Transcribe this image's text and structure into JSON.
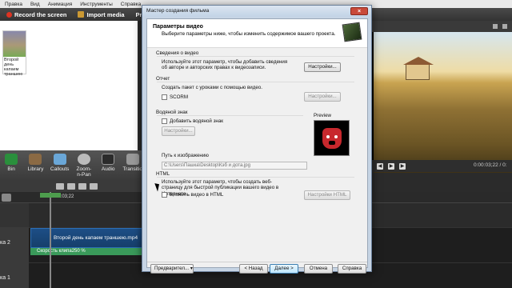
{
  "menu": [
    "Правка",
    "Вид",
    "Анимация",
    "Инструменты",
    "Справка"
  ],
  "toolbar": {
    "record": "Record the screen",
    "import": "Import media",
    "produce": "Produ"
  },
  "bin": {
    "clip_caption": "Второй день капаем траншею"
  },
  "tools": [
    "Bin",
    "Library",
    "Callouts",
    "Zoom-n-Pan",
    "Audio",
    "Transitio"
  ],
  "timeline": {
    "time": "0:00:03;22",
    "track2": "ка 2",
    "track1": "ка 1",
    "clip_name": "Второй день капаем траншею.mp4",
    "speed": "Скорость клипа250 %"
  },
  "player": {
    "timecode": "0:00:03;22 / 0:"
  },
  "dialog": {
    "title": "Мастер создания фильма",
    "header_title": "Параметры видео",
    "header_sub": "Выберите параметры ниже, чтобы изменить содержимое вашего проекта.",
    "s1_title": "Сведения о видео",
    "s1_text": "Используйте этот параметр, чтобы добавить сведения об авторе и авторских правах к видеозаписи.",
    "s1_btn": "Настройки...",
    "s2_title": "Отчет",
    "s2_text": "Создать пакет с уроками с помощью видео.",
    "s2_chk": "SCORM",
    "s2_btn": "Настройки...",
    "s3_title": "Водяной знак",
    "s3_chk": "Добавить водяной знак",
    "s3_btn": "Настройки...",
    "s3_path_label": "Путь к изображению",
    "s3_path": "C:\\Users\\Пашка\\Desktop\\Кэб и дота.jpg",
    "preview_label": "Preview",
    "s4_title": "HTML",
    "s4_text": "Используйте этот параметр, чтобы создать веб-страницу для быстрой публикации вашего видео в Интернете.",
    "s4_chk": "Вложить видео в HTML",
    "s4_btn": "Настройки HTML",
    "btn_preview": "Предварител...",
    "btn_back": "< Назад",
    "btn_next": "Далее >",
    "btn_cancel": "Отмена",
    "btn_help": "Справка"
  }
}
